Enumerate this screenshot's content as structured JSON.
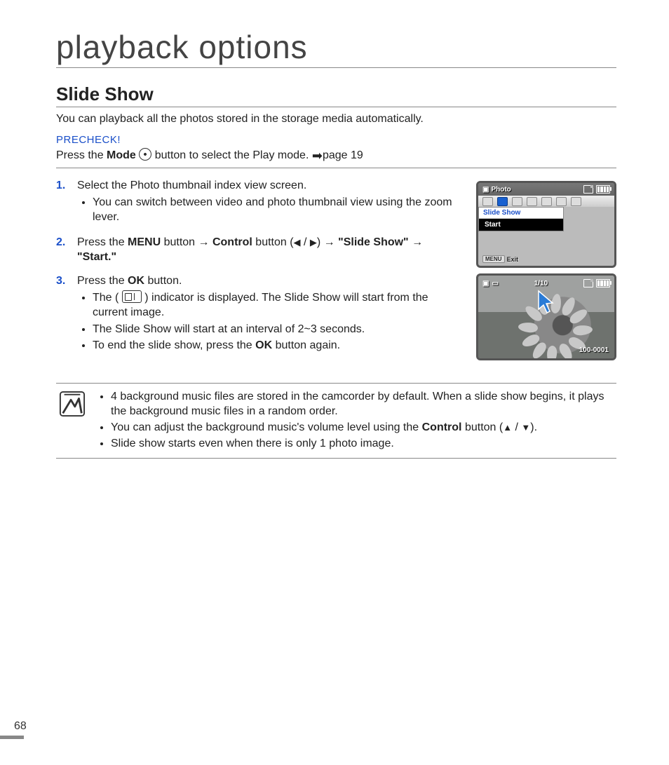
{
  "chapter_title": "playback options",
  "section_title": "Slide Show",
  "intro": "You can playback all the photos stored in the storage media automatically.",
  "precheck": {
    "label": "PRECHECK!",
    "prefix": "Press the ",
    "mode_word": "Mode",
    "mid": " button to select the Play mode. ",
    "page_ref": "page 19"
  },
  "steps": {
    "s1": {
      "num": "1.",
      "text": "Select the Photo thumbnail index view screen.",
      "b1": "You can switch between video and photo thumbnail view using the zoom lever."
    },
    "s2": {
      "num": "2.",
      "prefix": "Press the ",
      "menu": "MENU",
      "t1": " button ",
      "control": "Control",
      "t2": " button (",
      "t3": " / ",
      "t4": ") ",
      "slide": "\"Slide Show\"",
      "start": "\"Start.\""
    },
    "s3": {
      "num": "3.",
      "prefix": "Press the ",
      "ok": "OK",
      "suffix": " button.",
      "b1a": "The ( ",
      "b1b": " ) indicator is displayed. The Slide Show will start from the current image.",
      "b2": "The Slide Show will start at an interval of 2~3 seconds.",
      "b3a": "To end the slide show, press the ",
      "b3b": " button again."
    }
  },
  "screen1": {
    "title": "Photo",
    "menu_title": "Slide Show",
    "menu_item": "Start",
    "exit_btn": "MENU",
    "exit_label": "Exit"
  },
  "screen2": {
    "counter": "1/10",
    "filecode": "100-0001"
  },
  "notes": {
    "n1a": "4 background music files are stored in the camcorder by default. When a slide show begins, it plays the background music files in a random order.",
    "n2a": "You can adjust the background music's volume level using the ",
    "n2b": "Control",
    "n2c": " button (",
    "n2d": " / ",
    "n2e": ").",
    "n3": "Slide show starts even when there is only 1 photo image."
  },
  "page_number": "68"
}
